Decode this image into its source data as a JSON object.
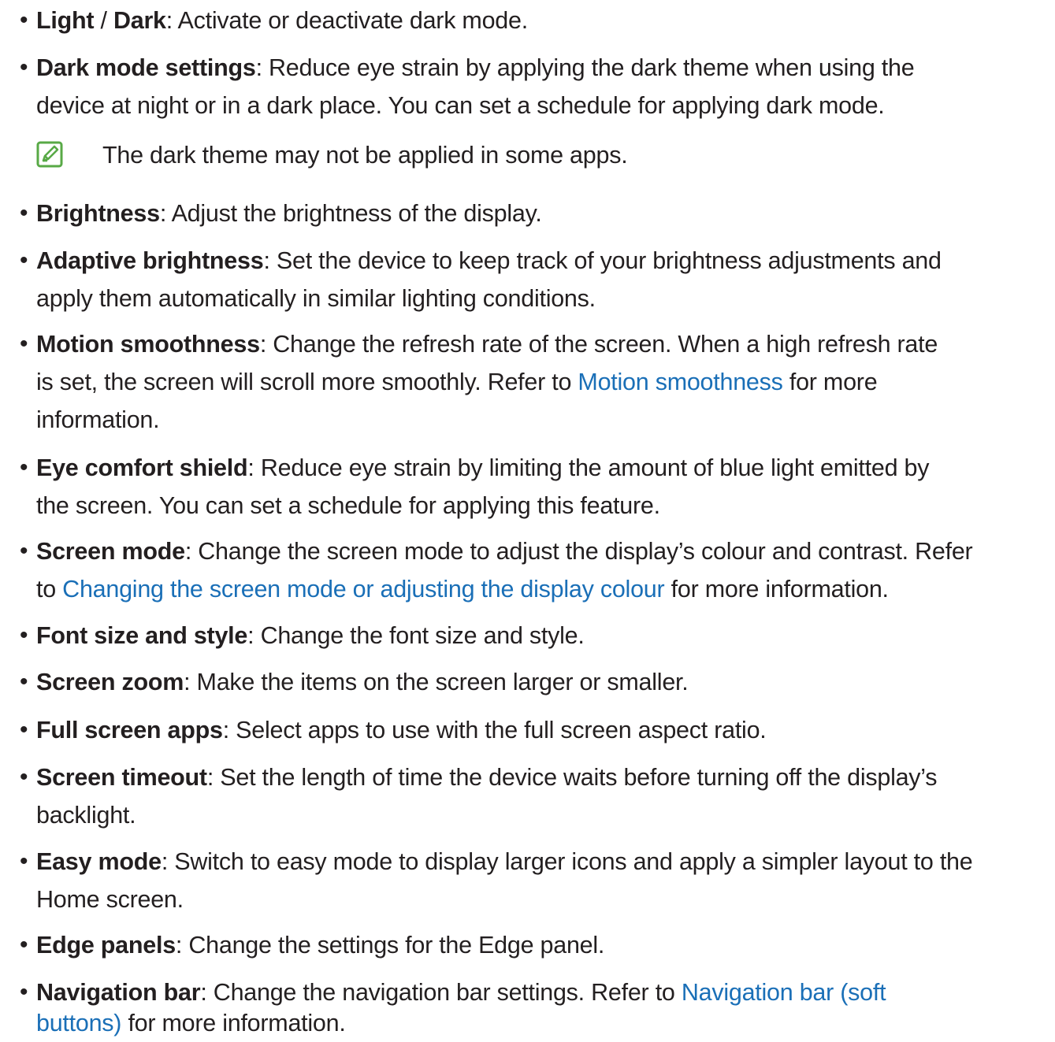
{
  "colors": {
    "text": "#231f20",
    "link": "#1a6fb7",
    "note_icon": "#58a946"
  },
  "bullet_glyph": "•",
  "items": [
    {
      "lines": [
        {
          "b1": "Light",
          "t1": " / ",
          "b2": "Dark",
          "t2": ": Activate or deactivate dark mode."
        }
      ]
    },
    {
      "lines": [
        {
          "b1": "Dark mode settings",
          "t1": ": Reduce eye strain by applying the dark theme when using the"
        },
        {
          "t1": "device at night or in a dark place. You can set a schedule for applying dark mode."
        }
      ]
    },
    {
      "note": {
        "icon": "note-pencil-icon",
        "text": "The dark theme may not be applied in some apps."
      }
    },
    {
      "lines": [
        {
          "b1": "Brightness",
          "t1": ": Adjust the brightness of the display."
        }
      ]
    },
    {
      "lines": [
        {
          "b1": "Adaptive brightness",
          "t1": ": Set the device to keep track of your brightness adjustments and"
        },
        {
          "t1": "apply them automatically in similar lighting conditions."
        }
      ]
    },
    {
      "lines": [
        {
          "b1": "Motion smoothness",
          "t1": ": Change the refresh rate of the screen. When a high refresh rate"
        },
        {
          "t1": "is set, the screen will scroll more smoothly. Refer to ",
          "link": "Motion smoothness",
          "t2": " for more"
        },
        {
          "t1": "information."
        }
      ]
    },
    {
      "lines": [
        {
          "b1": "Eye comfort shield",
          "t1": ": Reduce eye strain by limiting the amount of blue light emitted by"
        },
        {
          "t1": "the screen. You can set a schedule for applying this feature."
        }
      ]
    },
    {
      "lines": [
        {
          "b1": "Screen mode",
          "t1": ": Change the screen mode to adjust the display’s colour and contrast. Refer"
        },
        {
          "t1": "to ",
          "link": "Changing the screen mode or adjusting the display colour",
          "t2": " for more information."
        }
      ]
    },
    {
      "lines": [
        {
          "b1": "Font size and style",
          "t1": ": Change the font size and style."
        }
      ]
    },
    {
      "lines": [
        {
          "b1": "Screen zoom",
          "t1": ": Make the items on the screen larger or smaller."
        }
      ]
    },
    {
      "lines": [
        {
          "b1": "Full screen apps",
          "t1": ": Select apps to use with the full screen aspect ratio."
        }
      ]
    },
    {
      "lines": [
        {
          "b1": "Screen timeout",
          "t1": ": Set the length of time the device waits before turning off the display’s"
        },
        {
          "t1": "backlight."
        }
      ]
    },
    {
      "lines": [
        {
          "b1": "Easy mode",
          "t1": ": Switch to easy mode to display larger icons and apply a simpler layout to the"
        },
        {
          "t1": "Home screen."
        }
      ]
    },
    {
      "lines": [
        {
          "b1": "Edge panels",
          "t1": ": Change the settings for the Edge panel."
        }
      ]
    },
    {
      "lines": [
        {
          "b1": "Navigation bar",
          "t1": ": Change the navigation bar settings. Refer to ",
          "link": "Navigation bar (soft"
        },
        {
          "link": "buttons)",
          "t1": " for more information."
        }
      ]
    }
  ]
}
